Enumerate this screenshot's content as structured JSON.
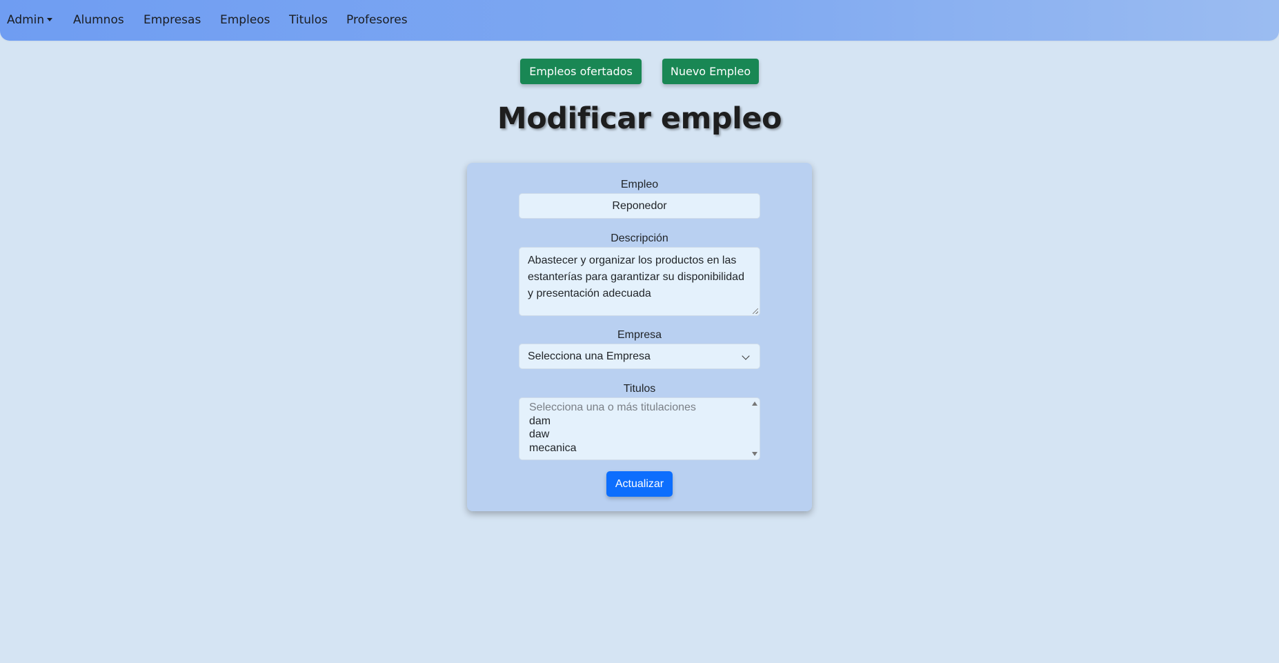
{
  "nav": {
    "admin_label": "Admin",
    "items": [
      "Alumnos",
      "Empresas",
      "Empleos",
      "Titulos",
      "Profesores"
    ]
  },
  "actions": {
    "offered_jobs_label": "Empleos ofertados",
    "new_job_label": "Nuevo Empleo"
  },
  "page_title": "Modificar empleo",
  "form": {
    "job_label": "Empleo",
    "job_value": "Reponedor",
    "description_label": "Descripción",
    "description_value": "Abastecer y organizar los productos en las estanterías para garantizar su disponibilidad y presentación adecuada",
    "company_label": "Empresa",
    "company_selected": "Selecciona una Empresa",
    "titles_label": "Titulos",
    "titles_options": [
      "Selecciona una o más titulaciones",
      "dam",
      "daw",
      "mecanica"
    ],
    "submit_label": "Actualizar"
  },
  "colors": {
    "navbar": "#7ea8f1",
    "background": "#d5e4f3",
    "card": "#b9d0f1",
    "green_button": "#198754",
    "blue_button": "#0d6efd"
  }
}
